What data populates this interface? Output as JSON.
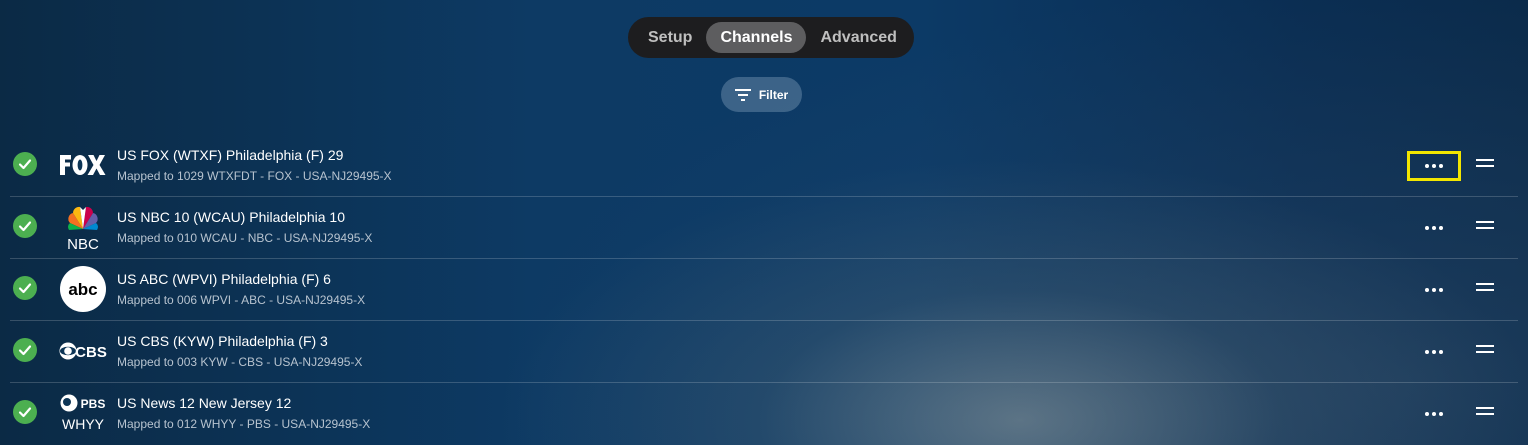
{
  "tabs": [
    {
      "label": "Setup",
      "active": false
    },
    {
      "label": "Channels",
      "active": true
    },
    {
      "label": "Advanced",
      "active": false
    }
  ],
  "filter": {
    "label": "Filter",
    "icon": "filter-icon"
  },
  "channels": [
    {
      "title": "US FOX (WTXF) Philadelphia (F) 29",
      "mapping": "Mapped to 1029 WTXFDT - FOX - USA-NJ29495-X",
      "logo": "fox-logo",
      "status": "check-icon"
    },
    {
      "title": "US NBC 10 (WCAU) Philadelphia 10",
      "mapping": "Mapped to 010 WCAU - NBC - USA-NJ29495-X",
      "logo": "nbc-logo",
      "logo_text": "NBC",
      "status": "check-icon"
    },
    {
      "title": "US ABC (WPVI) Philadelphia (F) 6",
      "mapping": "Mapped to 006 WPVI - ABC - USA-NJ29495-X",
      "logo": "abc-logo",
      "logo_text": "abc",
      "status": "check-icon"
    },
    {
      "title": "US CBS (KYW) Philadelphia (F) 3",
      "mapping": "Mapped to 003 KYW - CBS - USA-NJ29495-X",
      "logo": "cbs-logo",
      "logo_text": "CBS",
      "status": "check-icon"
    },
    {
      "title": "US News 12 New Jersey 12",
      "mapping": "Mapped to 012 WHYY - PBS - USA-NJ29495-X",
      "logo": "pbs-whyy-logo",
      "logo_text": "PBS",
      "logo_subtext": "WHYY",
      "status": "check-icon"
    }
  ],
  "colors": {
    "accent_check": "#4caf50",
    "highlight": "#f3e600"
  }
}
